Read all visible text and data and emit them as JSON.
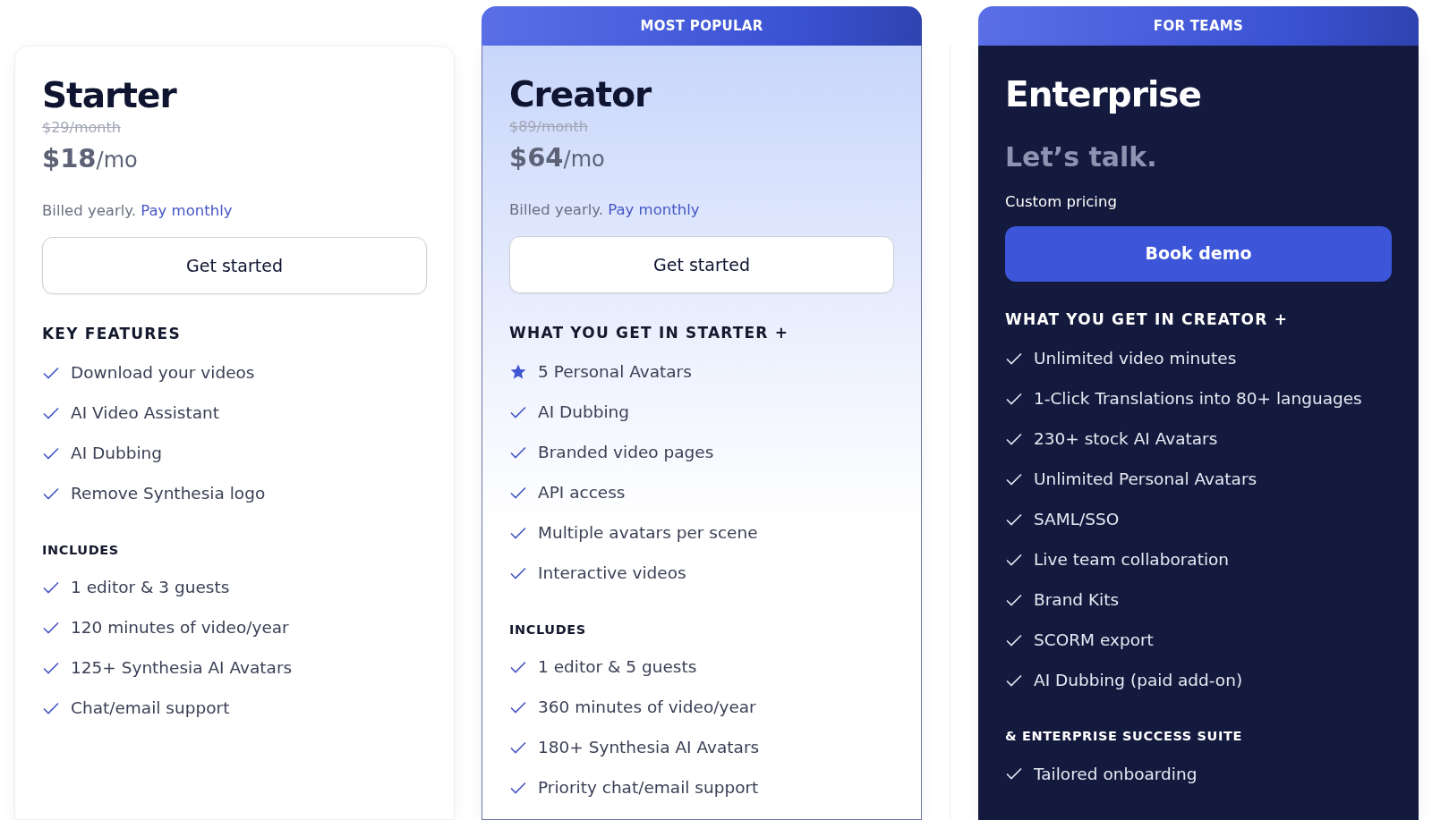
{
  "plans": [
    {
      "kind": "standard",
      "name": "Starter",
      "old_price": "$29/month",
      "price": "$18",
      "price_unit": "/mo",
      "billing": "Billed yearly.",
      "billing_link": "Pay monthly",
      "button": "Get started",
      "sections": [
        {
          "heading": "KEY FEATURES",
          "kind": "primary",
          "items": [
            {
              "kind": "check",
              "text": "Download your videos"
            },
            {
              "kind": "check",
              "text": "AI Video Assistant"
            },
            {
              "kind": "check",
              "text": "AI Dubbing"
            },
            {
              "kind": "check",
              "text": "Remove Synthesia logo"
            }
          ]
        },
        {
          "heading": "INCLUDES",
          "kind": "secondary",
          "items": [
            {
              "kind": "check",
              "text": "1 editor & 3 guests"
            },
            {
              "kind": "check",
              "text": "120 minutes of video/year"
            },
            {
              "kind": "check",
              "text": "125+ Synthesia AI Avatars"
            },
            {
              "kind": "check",
              "text": "Chat/email support"
            }
          ]
        }
      ]
    },
    {
      "kind": "featured",
      "banner": "MOST POPULAR",
      "name": "Creator",
      "old_price": "$89/month",
      "price": "$64",
      "price_unit": "/mo",
      "billing": "Billed yearly.",
      "billing_link": "Pay monthly",
      "button": "Get started",
      "sections": [
        {
          "heading": "WHAT YOU GET IN STARTER +",
          "kind": "primary",
          "items": [
            {
              "kind": "star",
              "text": "5 Personal Avatars"
            },
            {
              "kind": "check",
              "text": "AI Dubbing"
            },
            {
              "kind": "check",
              "text": "Branded video pages"
            },
            {
              "kind": "check",
              "text": "API access"
            },
            {
              "kind": "check",
              "text": "Multiple avatars per scene"
            },
            {
              "kind": "check",
              "text": "Interactive videos"
            }
          ]
        },
        {
          "heading": "INCLUDES",
          "kind": "secondary",
          "items": [
            {
              "kind": "check",
              "text": "1 editor & 5 guests"
            },
            {
              "kind": "check",
              "text": "360 minutes of video/year"
            },
            {
              "kind": "check",
              "text": "180+ Synthesia AI Avatars"
            },
            {
              "kind": "check",
              "text": "Priority chat/email support"
            }
          ]
        }
      ]
    },
    {
      "kind": "dark",
      "banner": "FOR TEAMS",
      "name": "Enterprise",
      "price": "Let’s talk.",
      "billing": "Custom pricing",
      "button": "Book demo",
      "sections": [
        {
          "heading": "WHAT YOU GET IN CREATOR +",
          "kind": "primary",
          "items": [
            {
              "kind": "check",
              "text": "Unlimited video minutes"
            },
            {
              "kind": "check",
              "text": "1-Click Translations into 80+ languages"
            },
            {
              "kind": "check",
              "text": "230+ stock AI Avatars"
            },
            {
              "kind": "check",
              "text": "Unlimited Personal Avatars"
            },
            {
              "kind": "check",
              "text": "SAML/SSO"
            },
            {
              "kind": "check",
              "text": "Live team collaboration"
            },
            {
              "kind": "check",
              "text": "Brand Kits"
            },
            {
              "kind": "check",
              "text": "SCORM export"
            },
            {
              "kind": "check",
              "text": "AI Dubbing (paid add-on)"
            }
          ]
        },
        {
          "heading": "& ENTERPRISE SUCCESS SUITE",
          "kind": "secondary",
          "items": [
            {
              "kind": "check",
              "text": "Tailored onboarding"
            }
          ]
        }
      ]
    }
  ]
}
